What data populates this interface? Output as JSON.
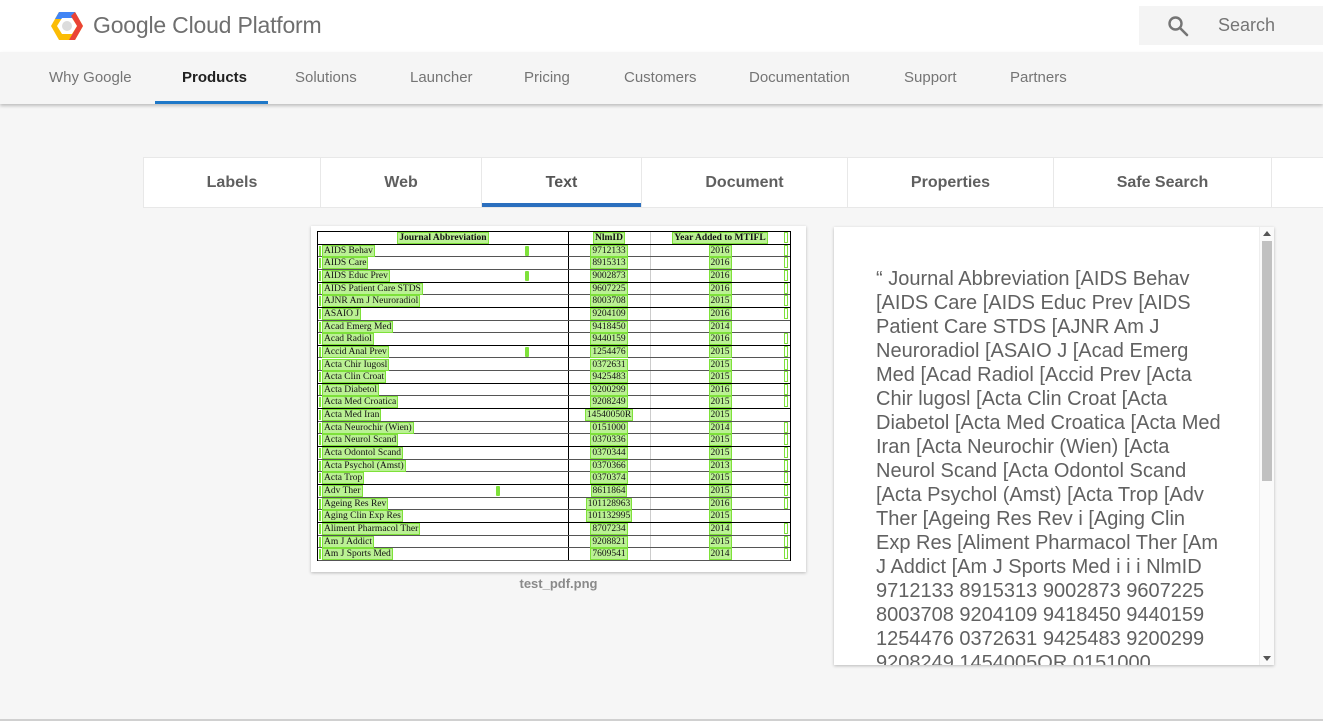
{
  "header": {
    "brand": "Google Cloud Platform",
    "search_label": "Search"
  },
  "nav": {
    "items": [
      {
        "label": "Why Google"
      },
      {
        "label": "Products",
        "active": true
      },
      {
        "label": "Solutions"
      },
      {
        "label": "Launcher"
      },
      {
        "label": "Pricing"
      },
      {
        "label": "Customers"
      },
      {
        "label": "Documentation"
      },
      {
        "label": "Support"
      },
      {
        "label": "Partners"
      }
    ]
  },
  "tabs": {
    "items": [
      {
        "label": "Labels"
      },
      {
        "label": "Web"
      },
      {
        "label": "Text",
        "active": true
      },
      {
        "label": "Document"
      },
      {
        "label": "Properties"
      },
      {
        "label": "Safe Search"
      },
      {
        "label": ""
      }
    ]
  },
  "image_preview": {
    "filename": "test_pdf.png",
    "table": {
      "headers": [
        "Journal Abbreviation",
        "NlmID",
        "Year Added to MTIFL"
      ],
      "rows": [
        [
          "AIDS Behav",
          "9712133",
          "2016"
        ],
        [
          "AIDS Care",
          "8915313",
          "2016"
        ],
        [
          "AIDS Educ Prev",
          "9002873",
          "2016"
        ],
        [
          "AIDS Patient Care STDS",
          "9607225",
          "2016"
        ],
        [
          "AJNR Am J Neuroradiol",
          "8003708",
          "2015"
        ],
        [
          "ASAIO J",
          "9204109",
          "2016"
        ],
        [
          "Acad Emerg Med",
          "9418450",
          "2014"
        ],
        [
          "Acad Radiol",
          "9440159",
          "2016"
        ],
        [
          "Accid Anal Prev",
          "1254476",
          "2015"
        ],
        [
          "Acta Chir Iugosl",
          "0372631",
          "2015"
        ],
        [
          "Acta Clin Croat",
          "9425483",
          "2015"
        ],
        [
          "Acta Diabetol",
          "9200299",
          "2016"
        ],
        [
          "Acta Med Croatica",
          "9208249",
          "2015"
        ],
        [
          "Acta Med Iran",
          "14540050R",
          "2015"
        ],
        [
          "Acta Neurochir (Wien)",
          "0151000",
          "2014"
        ],
        [
          "Acta Neurol Scand",
          "0370336",
          "2015"
        ],
        [
          "Acta Odontol Scand",
          "0370344",
          "2015"
        ],
        [
          "Acta Psychol (Amst)",
          "0370366",
          "2013"
        ],
        [
          "Acta Trop",
          "0370374",
          "2015"
        ],
        [
          "Adv Ther",
          "8611864",
          "2015"
        ],
        [
          "Ageing Res Rev",
          "101128963",
          "2016"
        ],
        [
          "Aging Clin Exp Res",
          "101132995",
          "2015"
        ],
        [
          "Aliment Pharmacol Ther",
          "8707234",
          "2014"
        ],
        [
          "Am J Addict",
          "9208821",
          "2015"
        ],
        [
          "Am J Sports Med",
          "7609541",
          "2014"
        ]
      ]
    }
  },
  "text_result": {
    "content": "“ Journal Abbreviation [AIDS Behav [AIDS Care [AIDS Educ Prev [AIDS Patient Care STDS [AJNR Am J Neuroradiol [ASAIO J [Acad Emerg Med [Acad Radiol [Accid Prev [Acta Chir lugosl [Acta Clin Croat [Acta Diabetol [Acta Med Croatica [Acta Med Iran [Acta Neurochir (Wien) [Acta Neurol Scand [Acta Odontol Scand [Acta Psychol (Amst) [Acta Trop [Adv Ther [Ageing Res Rev i [Aging Clin Exp Res [Aliment Pharmacol Ther [Am J Addict [Am J Sports Med i i i NlmID 9712133 8915313 9002873 9607225 8003708 9204109 9418450 9440159 1254476 0372631 9425483 9200299 9208249 1454005OR 0151000"
  },
  "colors": {
    "accent": "#1e78c8",
    "tab_accent": "#2b6fbe",
    "ocr_highlight": "#7ee13a",
    "page_bg": "#f6f6f6"
  }
}
